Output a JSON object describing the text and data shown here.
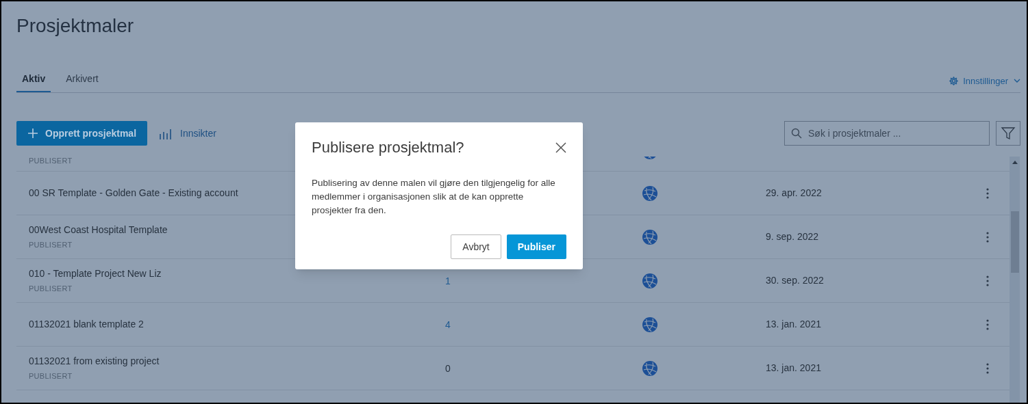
{
  "page": {
    "title": "Prosjektmaler"
  },
  "tabs": [
    {
      "label": "Aktiv",
      "selected": true
    },
    {
      "label": "Arkivert",
      "selected": false
    }
  ],
  "settings": {
    "label": "Innstillinger"
  },
  "toolbar": {
    "create_button": "Opprett prosjektmal",
    "insights_link": "Innsikter",
    "search": {
      "placeholder": "Søk i prosjektmaler ..."
    }
  },
  "rows": [
    {
      "kind": "cut",
      "status": "PUBLISERT"
    },
    {
      "kind": "full",
      "name": "00 SR Template - Golden Gate - Existing account",
      "date": "29. apr. 2022"
    },
    {
      "kind": "full",
      "name": "00West Coast Hospital Template",
      "status": "PUBLISERT",
      "date": "9. sep. 2022"
    },
    {
      "kind": "full",
      "name": "010 - Template Project New Liz",
      "status": "PUBLISERT",
      "count": {
        "value": "1",
        "linked": true
      },
      "date": "30. sep. 2022"
    },
    {
      "kind": "full",
      "name": "01132021 blank template 2",
      "count": {
        "value": "4",
        "linked": true
      },
      "date": "13. jan. 2021"
    },
    {
      "kind": "full",
      "name": "01132021 from existing project",
      "status": "PUBLISERT",
      "count": {
        "value": "0",
        "linked": false
      },
      "date": "13. jan. 2021"
    }
  ],
  "dialog": {
    "title": "Publisere prosjektmal?",
    "body": "Publisering av denne malen vil gjøre den tilgjengelig for alle medlemmer i organisasjonen slik at de kan opprette prosjekter fra den.",
    "buttons": [
      {
        "label": "Avbryt",
        "kind": "secondary"
      },
      {
        "label": "Publiser",
        "kind": "primary"
      }
    ]
  }
}
